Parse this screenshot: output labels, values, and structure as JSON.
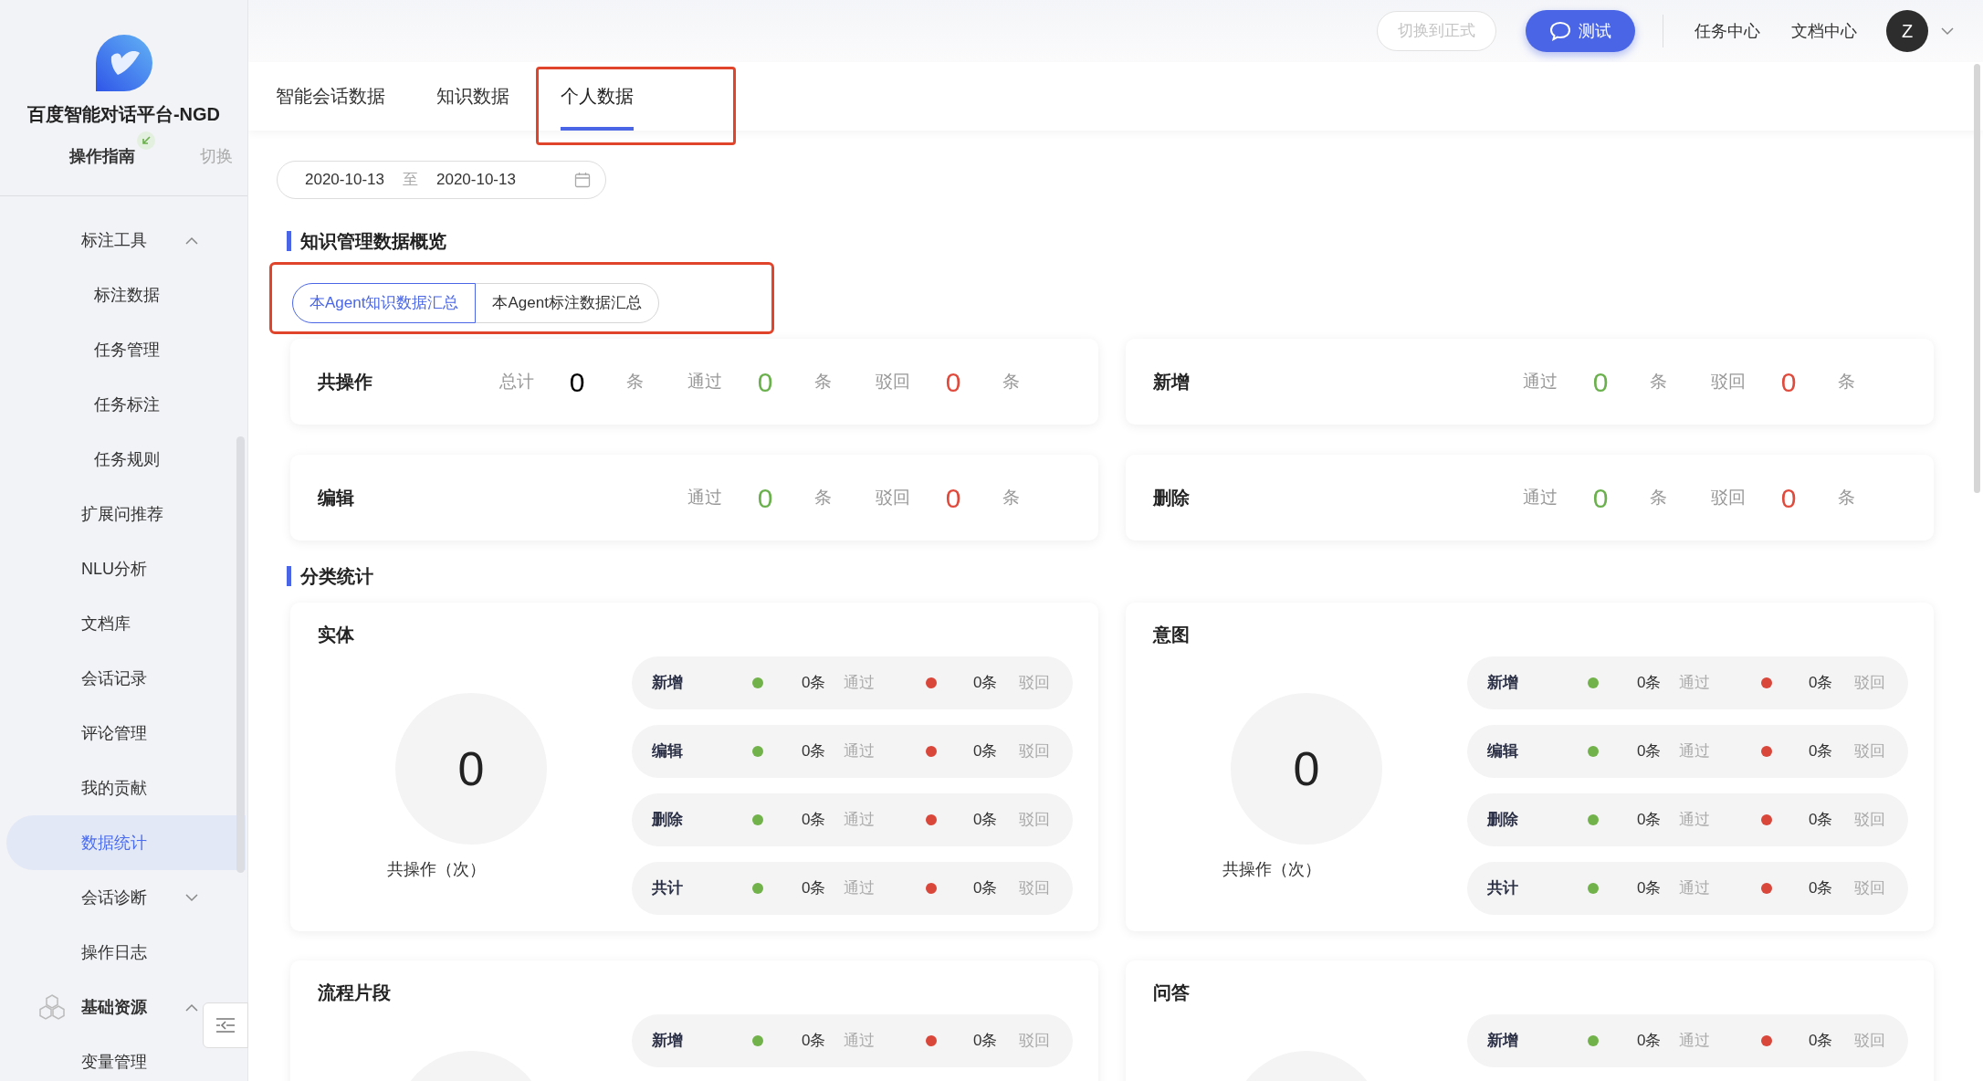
{
  "brand": {
    "title": "百度智能对话平台-NGD",
    "guide": "操作指南",
    "switch": "切换"
  },
  "sidebar": {
    "items": [
      {
        "label": "标注工具",
        "kind": "group",
        "expanded": true,
        "selected": false,
        "children": [
          {
            "label": "标注数据",
            "selected": false
          },
          {
            "label": "任务管理",
            "selected": false
          },
          {
            "label": "任务标注",
            "selected": false
          },
          {
            "label": "任务规则",
            "selected": false
          }
        ]
      },
      {
        "label": "扩展问推荐",
        "kind": "link",
        "selected": false
      },
      {
        "label": "NLU分析",
        "kind": "link",
        "selected": false
      },
      {
        "label": "文档库",
        "kind": "link",
        "selected": false
      },
      {
        "label": "会话记录",
        "kind": "link",
        "selected": false
      },
      {
        "label": "评论管理",
        "kind": "link",
        "selected": false
      },
      {
        "label": "我的贡献",
        "kind": "link",
        "selected": false
      },
      {
        "label": "数据统计",
        "kind": "link",
        "selected": true
      },
      {
        "label": "会话诊断",
        "kind": "group",
        "expanded": false,
        "selected": false
      },
      {
        "label": "操作日志",
        "kind": "link",
        "selected": false
      },
      {
        "label": "基础资源",
        "kind": "section",
        "expanded": true,
        "selected": false
      },
      {
        "label": "变量管理",
        "kind": "link",
        "selected": false
      }
    ]
  },
  "topbar": {
    "switch_button": {
      "label": "切换到正式",
      "disabled": true
    },
    "test_button": "测试",
    "links": [
      "任务中心",
      "文档中心"
    ],
    "avatar": "Z"
  },
  "tabs": [
    {
      "label": "智能会话数据",
      "selected": false,
      "annotated": false
    },
    {
      "label": "知识数据",
      "selected": false,
      "annotated": false
    },
    {
      "label": "个人数据",
      "selected": true,
      "annotated": true
    }
  ],
  "date_range": {
    "start": "2020-10-13",
    "separator": "至",
    "end": "2020-10-13"
  },
  "overview": {
    "title": "知识管理数据概览",
    "annotated": true,
    "segments": [
      {
        "label": "本Agent知识数据汇总",
        "selected": true
      },
      {
        "label": "本Agent标注数据汇总",
        "selected": false
      }
    ],
    "cards": [
      {
        "title": "共操作",
        "fields": [
          {
            "kind": "total",
            "label": "总计",
            "value": "0",
            "unit": "条"
          },
          {
            "kind": "pass",
            "label": "通过",
            "value": "0",
            "unit": "条"
          },
          {
            "kind": "reject",
            "label": "驳回",
            "value": "0",
            "unit": "条"
          }
        ]
      },
      {
        "title": "新增",
        "fields": [
          {
            "kind": "pass",
            "label": "通过",
            "value": "0",
            "unit": "条"
          },
          {
            "kind": "reject",
            "label": "驳回",
            "value": "0",
            "unit": "条"
          }
        ]
      },
      {
        "title": "编辑",
        "fields": [
          {
            "kind": "pass",
            "label": "通过",
            "value": "0",
            "unit": "条"
          },
          {
            "kind": "reject",
            "label": "驳回",
            "value": "0",
            "unit": "条"
          }
        ]
      },
      {
        "title": "删除",
        "fields": [
          {
            "kind": "pass",
            "label": "通过",
            "value": "0",
            "unit": "条"
          },
          {
            "kind": "reject",
            "label": "驳回",
            "value": "0",
            "unit": "条"
          }
        ]
      }
    ]
  },
  "categories": {
    "title": "分类统计",
    "cards": [
      {
        "title": "实体",
        "total": "0",
        "total_label": "共操作（次）",
        "rows": [
          {
            "label": "新增",
            "pass": "0条",
            "pass_label": "通过",
            "reject": "0条",
            "reject_label": "驳回"
          },
          {
            "label": "编辑",
            "pass": "0条",
            "pass_label": "通过",
            "reject": "0条",
            "reject_label": "驳回"
          },
          {
            "label": "删除",
            "pass": "0条",
            "pass_label": "通过",
            "reject": "0条",
            "reject_label": "驳回"
          },
          {
            "label": "共计",
            "pass": "0条",
            "pass_label": "通过",
            "reject": "0条",
            "reject_label": "驳回"
          }
        ]
      },
      {
        "title": "意图",
        "total": "0",
        "total_label": "共操作（次）",
        "rows": [
          {
            "label": "新增",
            "pass": "0条",
            "pass_label": "通过",
            "reject": "0条",
            "reject_label": "驳回"
          },
          {
            "label": "编辑",
            "pass": "0条",
            "pass_label": "通过",
            "reject": "0条",
            "reject_label": "驳回"
          },
          {
            "label": "删除",
            "pass": "0条",
            "pass_label": "通过",
            "reject": "0条",
            "reject_label": "驳回"
          },
          {
            "label": "共计",
            "pass": "0条",
            "pass_label": "通过",
            "reject": "0条",
            "reject_label": "驳回"
          }
        ]
      },
      {
        "title": "流程片段",
        "rows": [
          {
            "label": "新增",
            "pass": "0条",
            "pass_label": "通过",
            "reject": "0条",
            "reject_label": "驳回"
          }
        ]
      },
      {
        "title": "问答",
        "rows": [
          {
            "label": "新增",
            "pass": "0条",
            "pass_label": "通过",
            "reject": "0条",
            "reject_label": "驳回"
          }
        ]
      }
    ]
  }
}
